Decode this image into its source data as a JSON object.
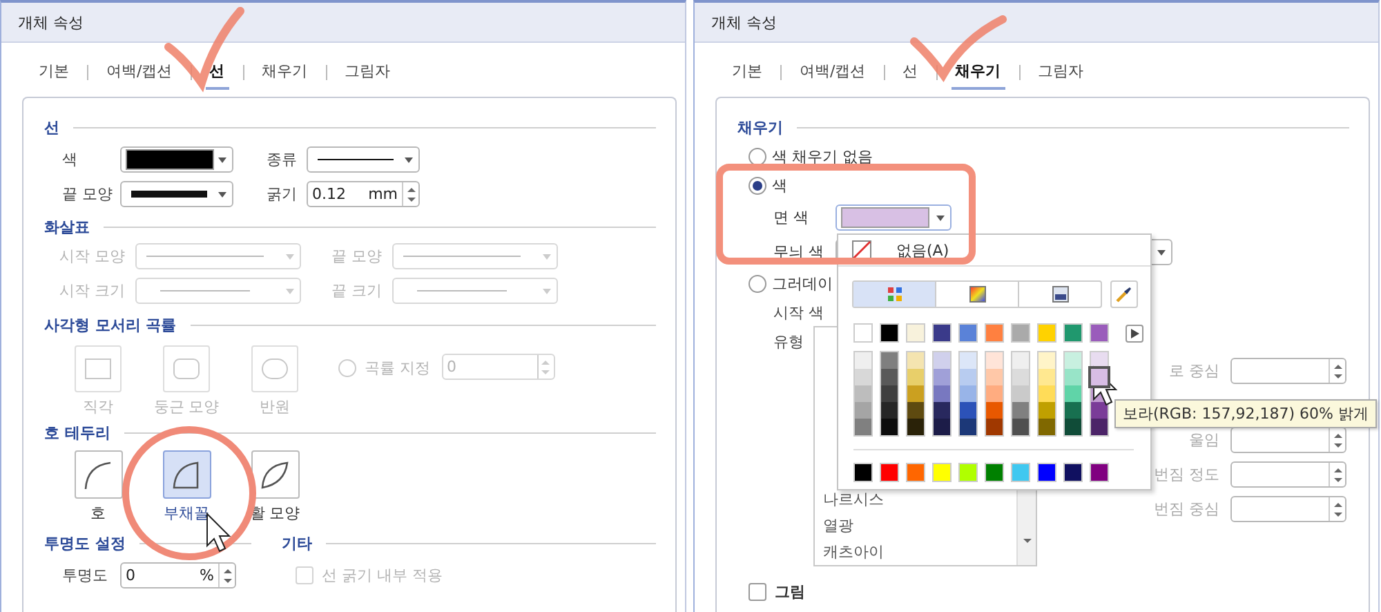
{
  "left_panel": {
    "title": "개체 속성",
    "tabs": [
      {
        "label": "기본",
        "selected": false
      },
      {
        "label": "여백/캡션",
        "selected": false
      },
      {
        "label": "선",
        "selected": true
      },
      {
        "label": "채우기",
        "selected": false
      },
      {
        "label": "그림자",
        "selected": false
      }
    ],
    "line": {
      "heading": "선",
      "color_label": "색",
      "color": "#000000",
      "type_label": "종류",
      "end_label": "끝 모양",
      "width_label": "굵기",
      "width_value": "0.12",
      "width_unit": "mm"
    },
    "arrows": {
      "heading": "화살표",
      "disabled": true,
      "fields": [
        "시작 모양",
        "끝 모양",
        "시작 크기",
        "끝 크기"
      ]
    },
    "corner": {
      "heading": "사각형 모서리 곡률",
      "disabled": true,
      "shapes": [
        {
          "label": "직각",
          "kind": "square",
          "selected": false
        },
        {
          "label": "둥근 모양",
          "kind": "rounded",
          "selected": false
        },
        {
          "label": "반원",
          "kind": "semicircle",
          "selected": false
        }
      ],
      "custom_label": "곡률 지정",
      "custom_checked": false,
      "custom_value": "0"
    },
    "arc": {
      "heading": "호 테두리",
      "shapes": [
        {
          "label": "호",
          "kind": "arc",
          "selected": false
        },
        {
          "label": "부채꼴",
          "kind": "pie",
          "selected": true
        },
        {
          "label": "활 모양",
          "kind": "chord",
          "selected": false
        }
      ]
    },
    "transparency": {
      "heading": "투명도 설정",
      "label": "투명도",
      "value": "0",
      "unit": "%"
    },
    "other": {
      "heading": "기타",
      "label": "선 굵기 내부 적용",
      "checked": false,
      "disabled": true
    }
  },
  "right_panel": {
    "title": "개체 속성",
    "tabs": [
      {
        "label": "기본",
        "selected": false
      },
      {
        "label": "여백/캡션",
        "selected": false
      },
      {
        "label": "선",
        "selected": false
      },
      {
        "label": "채우기",
        "selected": true
      },
      {
        "label": "그림자",
        "selected": false
      }
    ],
    "fill": {
      "heading": "채우기",
      "options": [
        {
          "label": "색 채우기 없음",
          "selected": false
        },
        {
          "label": "색",
          "selected": true
        },
        {
          "label": "그러데이",
          "selected": false
        }
      ],
      "face": {
        "label": "면 색",
        "color": "#d8c0e4"
      },
      "pattern_label": "무늬 색",
      "start_label": "시작 색",
      "type_label": "유형",
      "gradient_types": [
        "나르시스",
        "열광",
        "캐츠아이"
      ],
      "params": [
        "로 중심",
        "울임",
        "번짐 정도",
        "번짐 중심"
      ],
      "picture_label": "그림",
      "picture_checked": false
    },
    "popup": {
      "none_label": "없음(A)",
      "modes": [
        {
          "kind": "palette",
          "selected": true
        },
        {
          "kind": "spectrum",
          "selected": false
        },
        {
          "kind": "image",
          "selected": false
        }
      ],
      "columns": [
        {
          "color": "#ffffff",
          "shades": [
            {
              "color": "#efefef",
              "hovered": false
            },
            {
              "color": "#d8d8d8",
              "hovered": false
            },
            {
              "color": "#bdbdbd",
              "hovered": false
            },
            {
              "color": "#a5a5a5",
              "hovered": false
            },
            {
              "color": "#808080",
              "hovered": false
            }
          ]
        },
        {
          "color": "#000000",
          "shades": [
            {
              "color": "#7f7f7f",
              "hovered": false
            },
            {
              "color": "#595959",
              "hovered": false
            },
            {
              "color": "#3f3f3f",
              "hovered": false
            },
            {
              "color": "#262626",
              "hovered": false
            },
            {
              "color": "#0d0d0d",
              "hovered": false
            }
          ]
        },
        {
          "color": "#f8f2dc",
          "shades": [
            {
              "color": "#f4e4b0",
              "hovered": false
            },
            {
              "color": "#e8cf6a",
              "hovered": false
            },
            {
              "color": "#cba020",
              "hovered": false
            },
            {
              "color": "#5e4a10",
              "hovered": false
            },
            {
              "color": "#2a2208",
              "hovered": false
            }
          ]
        },
        {
          "color": "#3a3a8a",
          "shades": [
            {
              "color": "#d0d0ec",
              "hovered": false
            },
            {
              "color": "#a0a0d8",
              "hovered": false
            },
            {
              "color": "#7878c0",
              "hovered": false
            },
            {
              "color": "#28285e",
              "hovered": false
            },
            {
              "color": "#1c1c48",
              "hovered": false
            }
          ]
        },
        {
          "color": "#5a82d8",
          "shades": [
            {
              "color": "#dce6f8",
              "hovered": false
            },
            {
              "color": "#b8ccf0",
              "hovered": false
            },
            {
              "color": "#98b4e8",
              "hovered": false
            },
            {
              "color": "#2c52b8",
              "hovered": false
            },
            {
              "color": "#1c3878",
              "hovered": false
            }
          ]
        },
        {
          "color": "#ff8040",
          "shades": [
            {
              "color": "#ffe4d8",
              "hovered": false
            },
            {
              "color": "#ffc8a8",
              "hovered": false
            },
            {
              "color": "#ffac80",
              "hovered": false
            },
            {
              "color": "#e85800",
              "hovered": false
            },
            {
              "color": "#a03800",
              "hovered": false
            }
          ]
        },
        {
          "color": "#aaaaaa",
          "shades": [
            {
              "color": "#efefef",
              "hovered": false
            },
            {
              "color": "#dcdcdc",
              "hovered": false
            },
            {
              "color": "#cacaca",
              "hovered": false
            },
            {
              "color": "#808080",
              "hovered": false
            },
            {
              "color": "#505050",
              "hovered": false
            }
          ]
        },
        {
          "color": "#ffd200",
          "shades": [
            {
              "color": "#fff4c8",
              "hovered": false
            },
            {
              "color": "#ffe890",
              "hovered": false
            },
            {
              "color": "#ffdc58",
              "hovered": false
            },
            {
              "color": "#c0a000",
              "hovered": false
            },
            {
              "color": "#806800",
              "hovered": false
            }
          ]
        },
        {
          "color": "#20986e",
          "shades": [
            {
              "color": "#c8f0e0",
              "hovered": false
            },
            {
              "color": "#98e4c8",
              "hovered": false
            },
            {
              "color": "#60d4a8",
              "hovered": false
            },
            {
              "color": "#187050",
              "hovered": false
            },
            {
              "color": "#104c38",
              "hovered": false
            }
          ]
        },
        {
          "color": "#9a5cbb",
          "shades": [
            {
              "color": "#e8dcf0",
              "hovered": false
            },
            {
              "color": "#d7bde4",
              "hovered": true
            },
            {
              "color": "#c09ad0",
              "hovered": false
            },
            {
              "color": "#7a3c98",
              "hovered": false
            },
            {
              "color": "#4c2468",
              "hovered": false
            }
          ]
        }
      ],
      "standard": [
        {
          "color": "#000000"
        },
        {
          "color": "#ff0000"
        },
        {
          "color": "#ff6600"
        },
        {
          "color": "#ffff00"
        },
        {
          "color": "#b0ff00"
        },
        {
          "color": "#008000"
        },
        {
          "color": "#40c8f0"
        },
        {
          "color": "#0000ff"
        },
        {
          "color": "#101060"
        },
        {
          "color": "#800080"
        }
      ],
      "tooltip": "보라(RGB: 157,92,187) 60% 밝게"
    }
  }
}
